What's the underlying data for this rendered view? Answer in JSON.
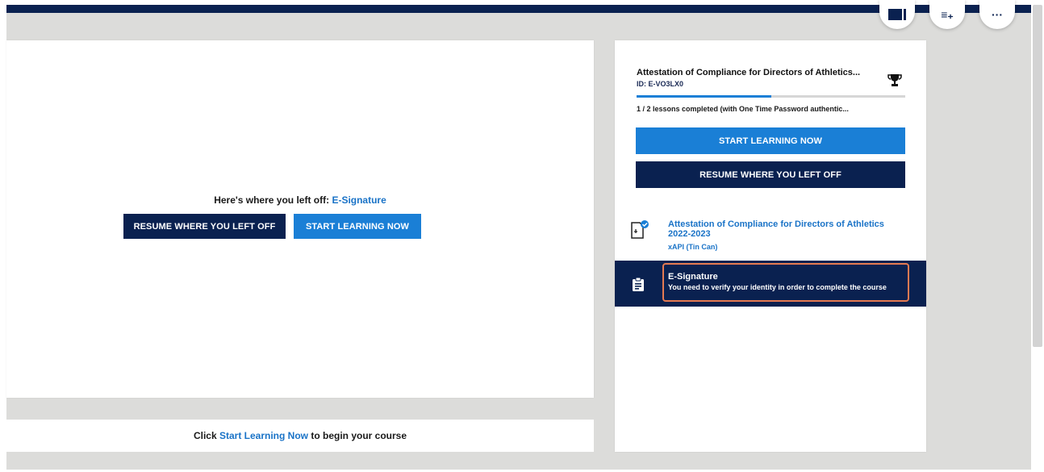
{
  "colors": {
    "navy": "#0a2150",
    "accent_blue": "#1a7fd6",
    "link_blue": "#1a73c7",
    "highlight": "#e57a52",
    "backdrop": "#dcdcda"
  },
  "toolbar": {
    "icons": [
      "view-layout-icon",
      "playlist-add-icon",
      "more-options-icon"
    ],
    "more_glyph": "···",
    "list_glyph": "≡₊"
  },
  "main": {
    "left_off_prefix": "Here's where you left off: ",
    "left_off_lesson": "E-Signature",
    "resume_label": "RESUME WHERE YOU LEFT OFF",
    "start_label": "START LEARNING NOW"
  },
  "bottom": {
    "prefix": "Click ",
    "link": "Start Learning Now",
    "suffix": " to begin your course"
  },
  "sidebar": {
    "course_title": "Attestation of Compliance for Directors of Athletics...",
    "course_id": "ID: E-VO3LX0",
    "progress_fraction": 0.5,
    "progress_text": "1 / 2 lessons completed (with One Time Password authentic...",
    "start_label": "START LEARNING NOW",
    "resume_label": "RESUME WHERE YOU LEFT OFF",
    "lessons": [
      {
        "title": "Attestation of Compliance for Directors of Athletics 2022-2023",
        "type": "xAPI (Tin Can)",
        "icon": "completed-document-icon",
        "completed": true
      },
      {
        "title": "E-Signature",
        "note": "You need to verify your identity in order to complete the course",
        "icon": "clipboard-icon",
        "current": true
      }
    ]
  }
}
